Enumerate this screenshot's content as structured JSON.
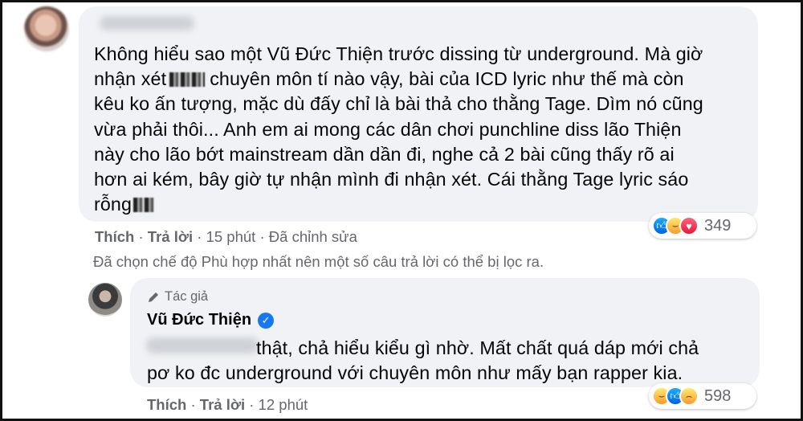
{
  "comment": {
    "lines": [
      "Không hiểu sao một Vũ Đức Thiện trước dissing từ underground. Mà giờ",
      "nhận xét",
      "chuyên môn tí nào vậy, bài của ICD lyric như thế mà còn",
      "kêu ko ấn tượng, mặc dù đấy chỉ là bài thả cho thằng Tage. Dìm nó cũng",
      "vừa phải thôi... Anh em ai mong các dân chơi punchline diss lão Thiện",
      "này cho lão bớt mainstream dần dần đi, nghe cả 2 bài cũng thấy rõ ai",
      "hơn ai kém, bây giờ tự nhận mình đi nhận xét. Cái thằng Tage lyric sáo",
      "rỗng"
    ],
    "actions": {
      "like": "Thích",
      "reply": "Trả lời",
      "time": "15 phút",
      "edited": "Đã chỉnh sửa"
    },
    "reaction_count": "349"
  },
  "filter_note": "Đã chọn chế độ Phù hợp nhất nên một số câu trả lời có thể bị lọc ra.",
  "reply": {
    "badge": "Tác giả",
    "author": "Vũ Đức Thiện",
    "lines": [
      "thật, chả hiểu kiểu gì nhờ. Mất chất quá dáp mới chả",
      "pơ ko đc underground với chuyên môn như mấy bạn rapper kia."
    ],
    "actions": {
      "like": "Thích",
      "reply": "Trả lời",
      "time": "12 phút"
    },
    "reaction_count": "598"
  },
  "icons": {
    "like": "like-reaction-icon",
    "haha": "haha-reaction-icon",
    "love": "love-reaction-icon",
    "sad": "sad-reaction-icon",
    "verified": "verified-badge-icon",
    "author": "pen-icon"
  },
  "colors": {
    "bubble": "#f0f2f5",
    "secondary_text": "#65676b",
    "verified": "#1877f2"
  }
}
